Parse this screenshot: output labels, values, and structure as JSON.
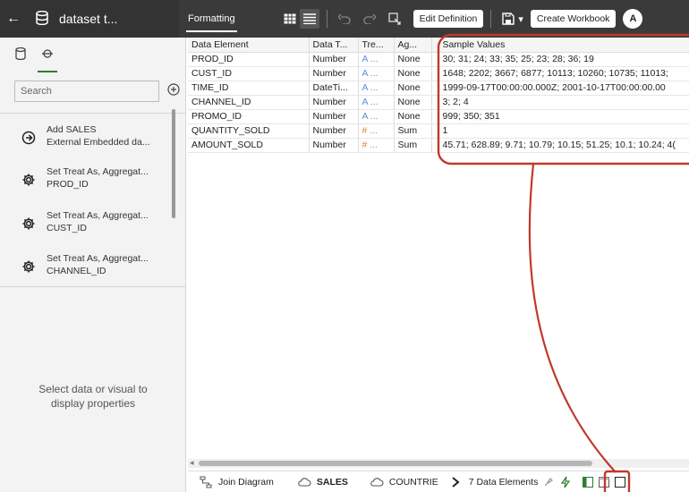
{
  "header": {
    "back_label": "←",
    "dataset_title": "dataset t...",
    "formatting_tab": "Formatting",
    "edit_definition": "Edit Definition",
    "save_menu_label": "▾",
    "create_workbook": "Create Workbook",
    "avatar_initial": "A"
  },
  "left_panel": {
    "search_placeholder": "Search",
    "history": [
      {
        "title": "Add SALES",
        "detail": "External Embedded da..."
      },
      {
        "title": "Set Treat As, Aggregat...",
        "detail": "PROD_ID"
      },
      {
        "title": "Set Treat As, Aggregat...",
        "detail": "CUST_ID"
      },
      {
        "title": "Set Treat As, Aggregat...",
        "detail": "CHANNEL_ID"
      }
    ],
    "properties_message_line1": "Select data or visual to",
    "properties_message_line2": "display properties"
  },
  "grid": {
    "columns": [
      "Data Element",
      "Data T...",
      "Tre...",
      "Ag...",
      "Sample Values"
    ],
    "rows": [
      [
        "PROD_ID",
        "Number",
        "A ...",
        "None",
        "30; 31; 24; 33; 35; 25; 23; 28; 36; 19"
      ],
      [
        "CUST_ID",
        "Number",
        "A ...",
        "None",
        "1648; 2202; 3667; 6877; 10113; 10260; 10735; 11013;"
      ],
      [
        "TIME_ID",
        "DateTi...",
        "A ...",
        "None",
        "1999-09-17T00:00:00.000Z; 2001-10-17T00:00:00.00"
      ],
      [
        "CHANNEL_ID",
        "Number",
        "A ...",
        "None",
        "3; 2; 4"
      ],
      [
        "PROMO_ID",
        "Number",
        "A ...",
        "None",
        "999; 350; 351"
      ],
      [
        "QUANTITY_SOLD",
        "Number",
        "# ...",
        "Sum",
        "1"
      ],
      [
        "AMOUNT_SOLD",
        "Number",
        "# ...",
        "Sum",
        "45.71; 628.89; 9.71; 10.79; 10.15; 51.25; 10.1; 10.24; 4("
      ]
    ]
  },
  "bottom": {
    "join_diagram": "Join Diagram",
    "sales_tab": "SALES",
    "countries_tab": "COUNTRIE",
    "data_elements": "7 Data Elements"
  },
  "colors": {
    "topbar": "#3a3a3a",
    "annotation": "#c0392b",
    "accent_green": "#2f7d32"
  }
}
